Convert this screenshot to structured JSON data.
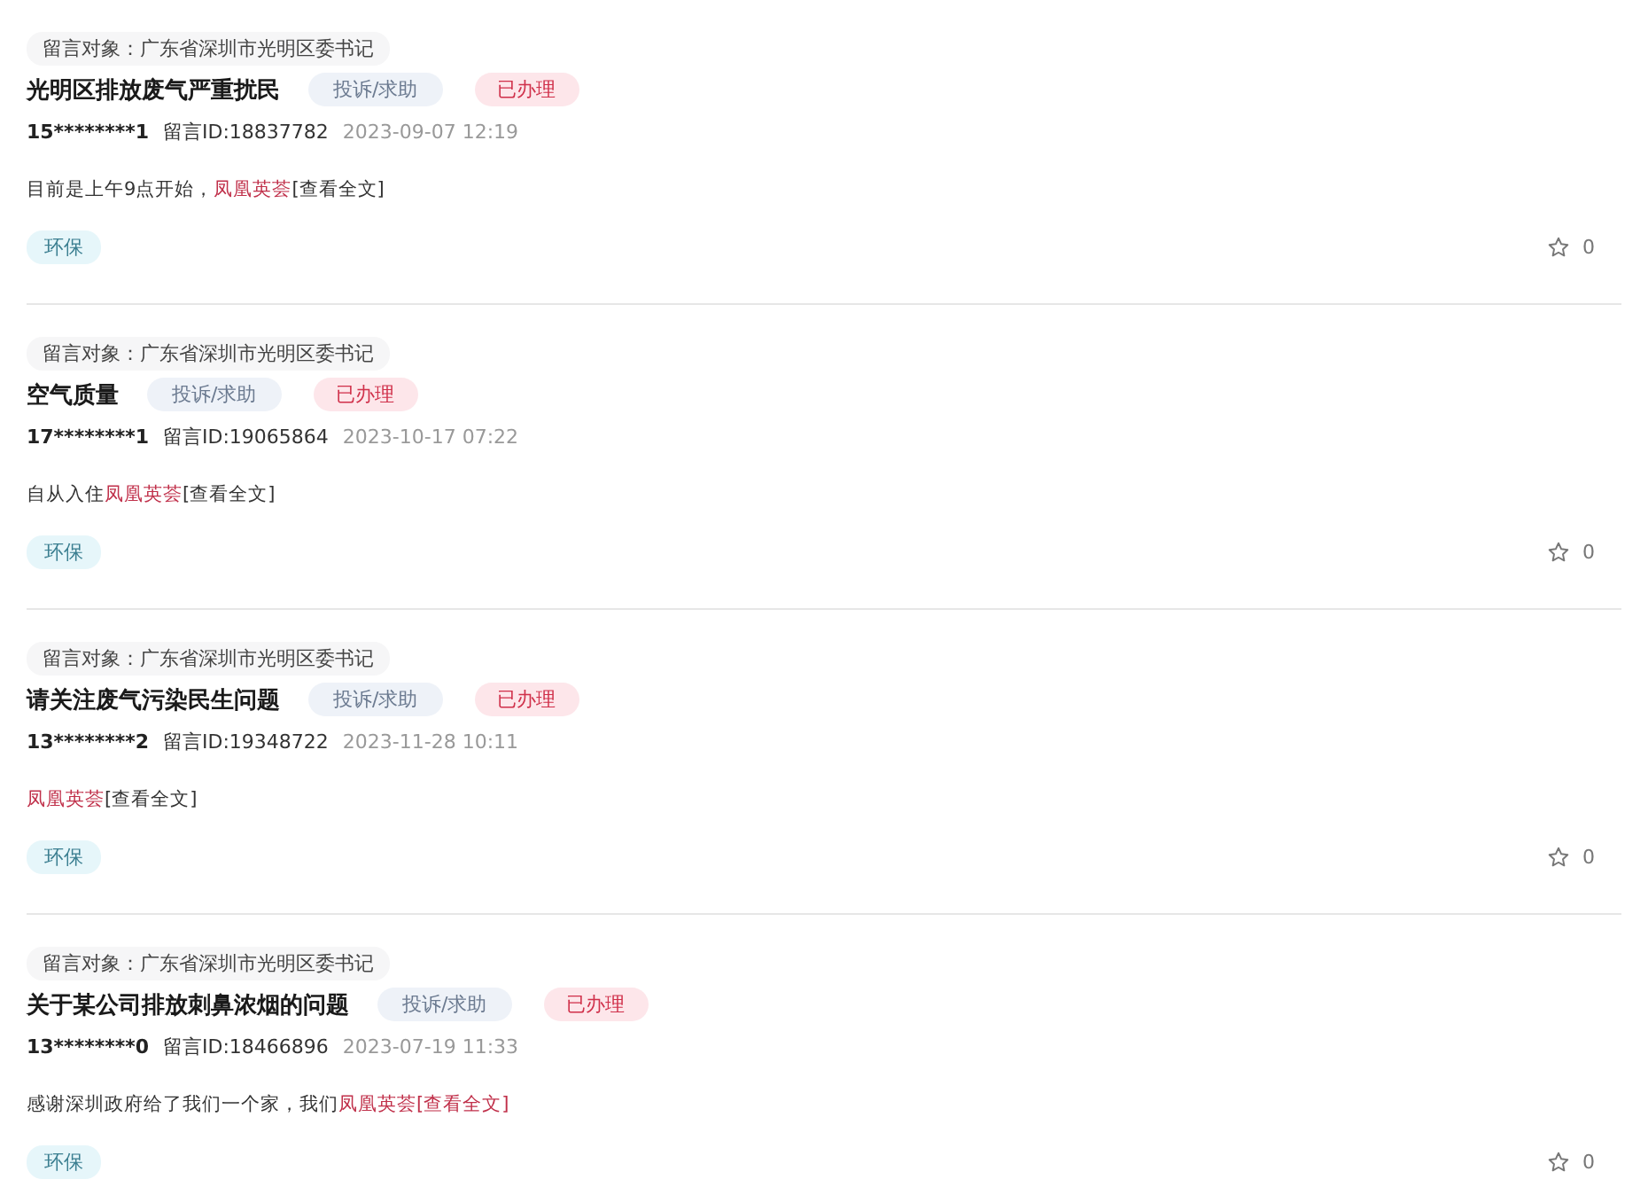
{
  "posts": [
    {
      "target": "留言对象：广东省深圳市光明区委书记",
      "title": "光明区排放废气严重扰民",
      "type_tag": "投诉/求助",
      "status": "已办理",
      "user": "15********1",
      "message_id": "留言ID:18837782",
      "time": "2023-09-07 12:19",
      "excerpt": {
        "text": "目前是上午9点开始，",
        "highlight": "凤凰英荟",
        "more": "[查看全文]",
        "more_highlighted": false
      },
      "category": "环保",
      "favorites": "0"
    },
    {
      "target": "留言对象：广东省深圳市光明区委书记",
      "title": "空气质量",
      "type_tag": "投诉/求助",
      "status": "已办理",
      "user": "17********1",
      "message_id": "留言ID:19065864",
      "time": "2023-10-17 07:22",
      "excerpt": {
        "text": "自从入住",
        "highlight": "凤凰英荟",
        "more": "[查看全文]",
        "more_highlighted": false
      },
      "category": "环保",
      "favorites": "0"
    },
    {
      "target": "留言对象：广东省深圳市光明区委书记",
      "title": "请关注废气污染民生问题",
      "type_tag": "投诉/求助",
      "status": "已办理",
      "user": "13********2",
      "message_id": "留言ID:19348722",
      "time": "2023-11-28 10:11",
      "excerpt": {
        "highlight": "凤凰英荟",
        "more": "[查看全文]",
        "more_highlighted": false
      },
      "category": "环保",
      "favorites": "0"
    },
    {
      "target": "留言对象：广东省深圳市光明区委书记",
      "title": "关于某公司排放刺鼻浓烟的问题",
      "type_tag": "投诉/求助",
      "status": "已办理",
      "user": "13********0",
      "message_id": "留言ID:18466896",
      "time": "2023-07-19 11:33",
      "excerpt": {
        "text": "感谢深圳政府给了我们一个家，我们",
        "highlight": "凤凰英荟",
        "more": "[查看全文]",
        "more_highlighted": true
      },
      "category": "环保",
      "favorites": "0"
    }
  ]
}
